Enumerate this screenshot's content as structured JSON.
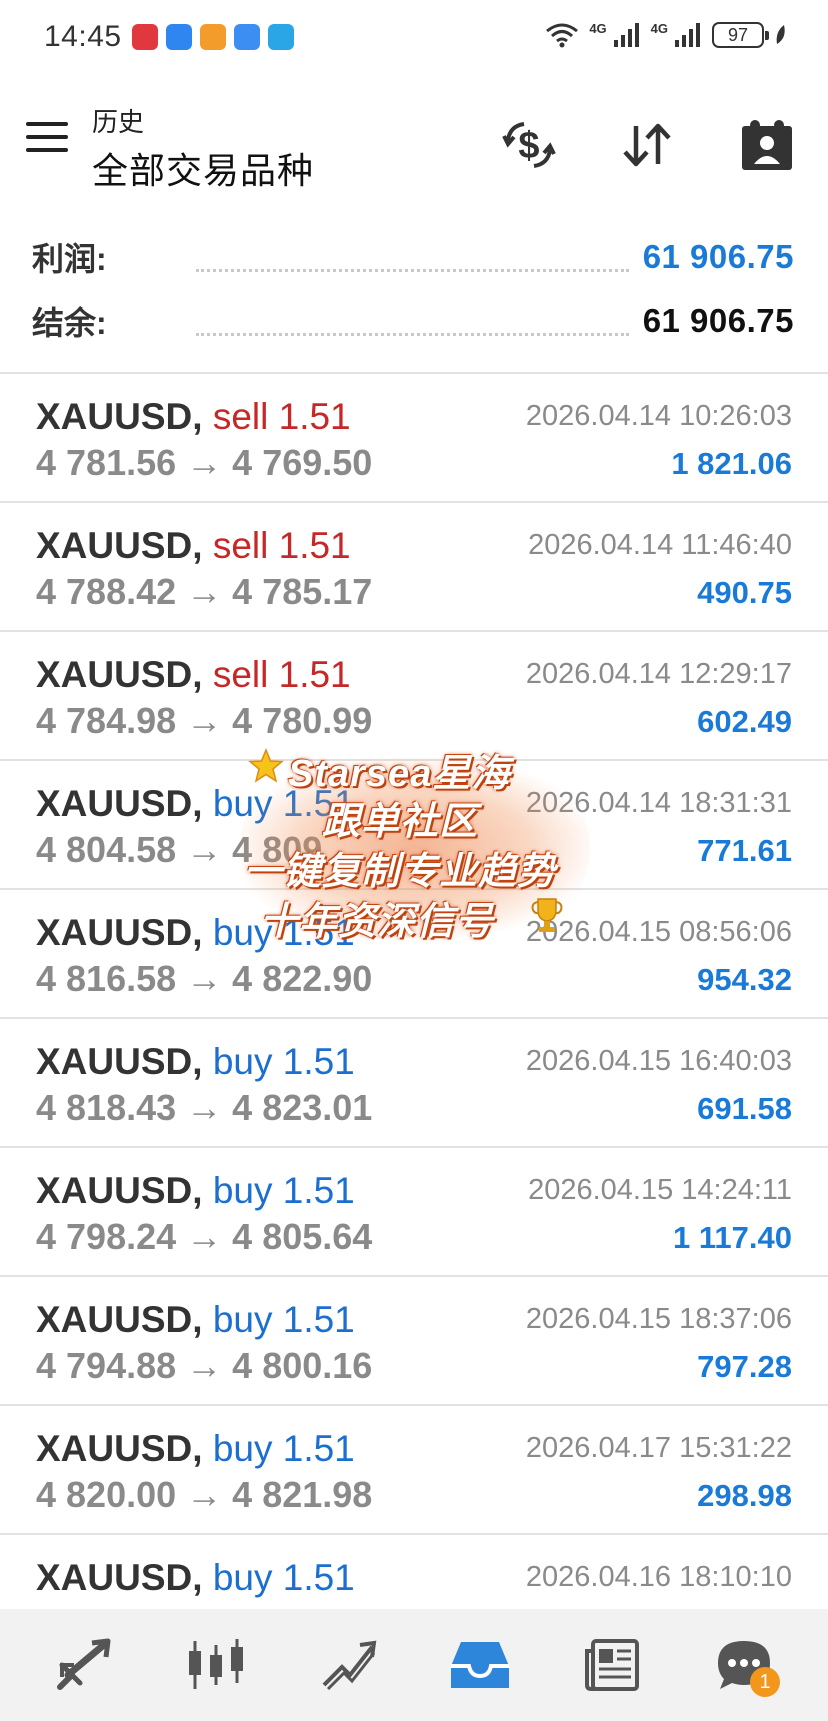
{
  "status_bar": {
    "time": "14:45",
    "battery": "97",
    "signal_labels": [
      "4G",
      "4G"
    ],
    "app_icon_colors": [
      "#e0383e",
      "#2f86f0",
      "#f39c2c",
      "#3c8ef3",
      "#2aa6e6"
    ]
  },
  "header": {
    "subtitle": "历史",
    "title": "全部交易品种",
    "buttons": [
      "currency-exchange-icon",
      "sort-icon",
      "account-icon"
    ]
  },
  "summary": {
    "profit_label": "利润:",
    "profit_value": "61 906.75",
    "balance_label": "结余:",
    "balance_value": "61 906.75"
  },
  "deals": [
    {
      "symbol": "XAUUSD,",
      "type": "sell",
      "volume": "1.51",
      "open": "4 781.56",
      "close": "4 769.50",
      "arrow": "→",
      "time": "2026.04.14 10:26:03",
      "profit": "1 821.06"
    },
    {
      "symbol": "XAUUSD,",
      "type": "sell",
      "volume": "1.51",
      "open": "4 788.42",
      "close": "4 785.17",
      "arrow": "→",
      "time": "2026.04.14 11:46:40",
      "profit": "490.75"
    },
    {
      "symbol": "XAUUSD,",
      "type": "sell",
      "volume": "1.51",
      "open": "4 784.98",
      "close": "4 780.99",
      "arrow": "→",
      "time": "2026.04.14 12:29:17",
      "profit": "602.49"
    },
    {
      "symbol": "XAUUSD,",
      "type": "buy",
      "volume": "1.51",
      "open": "4 804.58",
      "close": "4 809",
      "arrow": "→",
      "time": "2026.04.14 18:31:31",
      "profit": "771.61"
    },
    {
      "symbol": "XAUUSD,",
      "type": "buy",
      "volume": "1.51",
      "open": "4 816.58",
      "close": "4 822.90",
      "arrow": "→",
      "time": "2026.04.15 08:56:06",
      "profit": "954.32"
    },
    {
      "symbol": "XAUUSD,",
      "type": "buy",
      "volume": "1.51",
      "open": "4 818.43",
      "close": "4 823.01",
      "arrow": "→",
      "time": "2026.04.15 16:40:03",
      "profit": "691.58"
    },
    {
      "symbol": "XAUUSD,",
      "type": "buy",
      "volume": "1.51",
      "open": "4 798.24",
      "close": "4 805.64",
      "arrow": "→",
      "time": "2026.04.15 14:24:11",
      "profit": "1 117.40"
    },
    {
      "symbol": "XAUUSD,",
      "type": "buy",
      "volume": "1.51",
      "open": "4 794.88",
      "close": "4 800.16",
      "arrow": "→",
      "time": "2026.04.15 18:37:06",
      "profit": "797.28"
    },
    {
      "symbol": "XAUUSD,",
      "type": "buy",
      "volume": "1.51",
      "open": "4 820.00",
      "close": "4 821.98",
      "arrow": "→",
      "time": "2026.04.17 15:31:22",
      "profit": "298.98"
    },
    {
      "symbol": "XAUUSD,",
      "type": "buy",
      "volume": "1.51",
      "open": "",
      "close": "",
      "arrow": "",
      "time": "2026.04.16 18:10:10",
      "profit": ""
    }
  ],
  "watermark": {
    "lines": [
      "Starsea星海",
      "跟单社区",
      "一键复制专业趋势",
      "十年资深信号"
    ]
  },
  "bottom_nav": {
    "items": [
      "quotes-icon",
      "chart-icon",
      "trade-icon",
      "history-icon",
      "news-icon",
      "messages-icon"
    ],
    "active": "history-icon",
    "messages_badge": "1"
  },
  "colors": {
    "sell": "#c62828",
    "buy": "#1a6fd0",
    "profit": "#1a7ad8",
    "accent": "#1a7ad8"
  }
}
